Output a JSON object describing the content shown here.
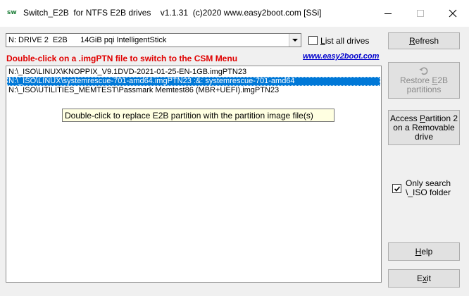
{
  "window": {
    "icon_text": "sw",
    "title": "Switch_E2B  for NTFS E2B drives    v1.1.31  (c)2020 www.easy2boot.com [SSi]"
  },
  "drive_select": {
    "value": "N: DRIVE 2  E2B      14GiB pqi IntelligentStick"
  },
  "list_all": {
    "label": "List all drives",
    "checked": false
  },
  "instruction": "Double-click on a .imgPTN file to switch to the CSM Menu",
  "link": "www.easy2boot.com",
  "files": [
    "N:\\_ISO\\LINUX\\KNOPPIX_V9.1DVD-2021-01-25-EN-1GB.imgPTN23",
    "N:\\_ISO\\LINUX\\systemrescue-701-amd64.imgPTN23 :&: systemrescue-701-amd64",
    "N:\\_ISO\\UTILITIES_MEMTEST\\Passmark Memtest86 (MBR+UEFI).imgPTN23"
  ],
  "selected_index": 1,
  "tooltip": "Double-click to replace E2B partition with the partition image file(s)",
  "buttons": {
    "refresh": "Refresh",
    "restore_line1": "Restore E2B",
    "restore_line2": "partitions",
    "access_line1": "Access Partition 2",
    "access_line2": "on a Removable",
    "access_line3": "drive",
    "help": "Help",
    "exit": "Exit"
  },
  "only_search": {
    "line1": "Only search",
    "line2": "\\_ISO folder",
    "checked": true
  },
  "icons": [
    "app-icon",
    "minimize-icon",
    "maximize-icon",
    "close-icon",
    "chevron-down-icon",
    "restore-icon",
    "checkmark-icon"
  ]
}
